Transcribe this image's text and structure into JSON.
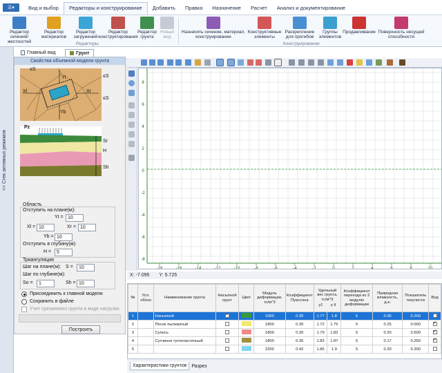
{
  "menubar": {
    "app_button": "",
    "tabs": [
      {
        "label": "Вид и выбор",
        "left": 30
      },
      {
        "label": "Редакторы и конструирование",
        "active": true
      },
      {
        "label": "Добавить"
      },
      {
        "label": "Правка"
      },
      {
        "label": "Назначение"
      },
      {
        "label": "Расчет"
      },
      {
        "label": "Анализ и документирование"
      }
    ]
  },
  "ribbon": {
    "editors": [
      {
        "label": "Редактор сечений/ жесткостей",
        "color": "#3d7fc6",
        "icon": "section-editor-icon"
      },
      {
        "label": "Редактор материалов",
        "color": "#e0a020",
        "icon": "materials-icon"
      },
      {
        "label": "Редактор загружений",
        "color": "#3aa6d8",
        "icon": "loads-editor-icon"
      },
      {
        "label": "Редактор конструктирования",
        "color": "#c0504d",
        "icon": "construction-editor-icon"
      },
      {
        "label": "Редактор грунта",
        "color": "#3f8f4f",
        "icon": "soil-editor-icon"
      },
      {
        "label": "Новый вид",
        "color": "#c5cbd4",
        "icon": "new-view-icon",
        "dim": true
      }
    ],
    "editors_caption": "Редакторы",
    "construction": [
      {
        "label": "Назначить сечение, материал, конструирование",
        "color": "#8e5bb5",
        "icon": "assign-section-icon"
      },
      {
        "label": "Конструктивные элементы",
        "color": "#d45757",
        "icon": "structural-elements-icon"
      },
      {
        "label": "Раскрепление для прогибов",
        "color": "#4a8fd4",
        "icon": "deflection-bracing-icon"
      },
      {
        "label": "Группы элементов",
        "color": "#3b9fd0",
        "icon": "element-groups-icon"
      },
      {
        "label": "Продавливание",
        "color": "#cc3333",
        "icon": "punching-icon"
      },
      {
        "label": "Поверхность несущей способности",
        "color": "#c23b6c",
        "icon": "bearing-surface-icon"
      }
    ],
    "construction_caption": "Конструирование"
  },
  "vertical_strip": {
    "label": "<< Стек активных режимов"
  },
  "doc_tabs": [
    {
      "label": "Главный вид"
    },
    {
      "label": "Грунт",
      "active": true
    }
  ],
  "left_panel": {
    "title": "Свойства объемной модели грунта",
    "diagram_labels": {
      "s_top": "≤S",
      "yt": "Yt",
      "xl": "Xl",
      "xr": "Xr",
      "yb": "Yb",
      "pz": "Pz",
      "s_right1": "≤S",
      "s_right2": "≤S",
      "sr": "Sr",
      "h": "H",
      "sh": "Sh"
    },
    "area": {
      "title": "Область",
      "plan_label": "Отступить на плане(м):",
      "yt_label": "Yt =",
      "yt": "10",
      "xl_label": "Xl =",
      "xl": "10",
      "xr_label": "Xr =",
      "xr": "10",
      "yb_label": "Yb =",
      "yb": "10",
      "depth_label": "Отступить в глубину(м):",
      "h_label": "H =",
      "h": "5"
    },
    "triangulation": {
      "title": "Триангуляция",
      "plan_step_label": "Шаг на плане(м):",
      "s_label": "S =",
      "s": "10",
      "depth_step_label": "Шаг по глубине(м):",
      "so_label": "So =",
      "so": "1",
      "sh_label": "Sh =",
      "sh": "10"
    },
    "options": {
      "attach_label": "Присоединить к главной модели",
      "save_label": "Сохранить в файле",
      "cutoff_label": "Учет срезаемого грунта в виде нагрузки"
    },
    "build_button": "Построить"
  },
  "canvas": {
    "x_ticks": [
      "-18",
      "-16",
      "-14",
      "-12",
      "-10",
      "-8",
      "-6",
      "-4",
      "-2",
      "0",
      "2",
      "4",
      "6",
      "8",
      "10"
    ],
    "y_ticks": [
      "8",
      "6",
      "4",
      "2",
      "0",
      "-2",
      "-4",
      "-6",
      "-8"
    ]
  },
  "coords": {
    "x": "X:  -7.095",
    "y": "Y:  5.725"
  },
  "soil_table": {
    "headers": [
      "№",
      "Усл. обозн",
      "Наименование грунта",
      "Насыпной грунт",
      "Цвет",
      "Модуль деформации, тс/м^2",
      "Коэффициент Пуассона",
      "Удельный вес грунта, тс/м^3",
      "Коэффициент перехода ко 2 модулю деформации",
      "Природная влажность, д.е.",
      "Показатель текучести",
      "Вод"
    ],
    "subheaders": {
      "gamma1": "γ1",
      "gamma2": "γ II"
    },
    "rows": [
      {
        "n": "1",
        "name": "Насыпной",
        "fill": true,
        "color": "#3a9a3a",
        "E": "1000",
        "nu": "0.30",
        "g1": "1.77",
        "g2": "1.8",
        "k": "5",
        "w": "0.05",
        "il": "0.200",
        "water": false,
        "selected": true
      },
      {
        "n": "2",
        "name": "Песок пылеватый",
        "fill": false,
        "color": "#f2ea6a",
        "E": "1800",
        "nu": "0.30",
        "g1": "1.72",
        "g2": "1.75",
        "k": "5",
        "w": "0.25",
        "il": "0.000",
        "water": true
      },
      {
        "n": "3",
        "name": "Супесь",
        "fill": false,
        "color": "#f08a8a",
        "E": "1800",
        "nu": "0.30",
        "g1": "1.79",
        "g2": "1.82",
        "k": "5",
        "w": "0.20",
        "il": "0.500",
        "water": true
      },
      {
        "n": "4",
        "name": "Суглинок тугопластичный",
        "fill": false,
        "color": "#a29040",
        "E": "1800",
        "nu": "0.35",
        "g1": "1.83",
        "g2": "1.87",
        "k": "5",
        "w": "0.17",
        "il": "0.260",
        "water": true
      },
      {
        "n": "5",
        "name": "",
        "fill": false,
        "color": "#7fd6f0",
        "E": "2200",
        "nu": "0.42",
        "g1": "1.85",
        "g2": "1.9",
        "k": "5",
        "w": "0.20",
        "il": "0.200",
        "water": false
      }
    ]
  },
  "bottom_tabs": [
    {
      "label": "Характеристики грунтов",
      "active": true
    },
    {
      "label": "Разрез"
    }
  ]
}
